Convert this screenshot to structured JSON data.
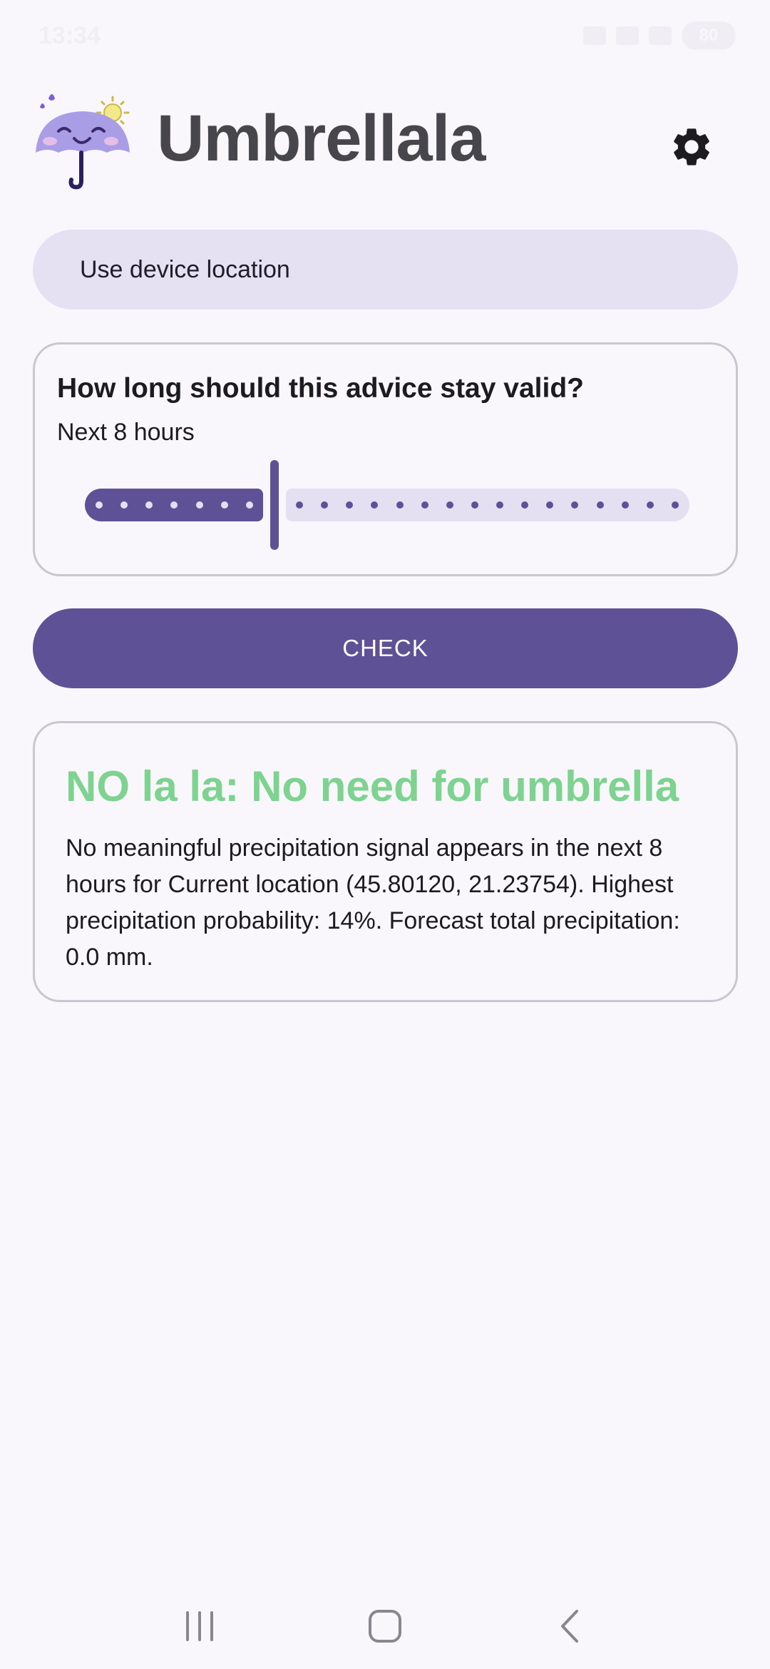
{
  "status_bar": {
    "time": "13:34",
    "battery": "80"
  },
  "header": {
    "title": "Umbrellala",
    "logo_icon": "umbrella-face-icon",
    "settings_icon": "gear-icon"
  },
  "location": {
    "label": "Use device location"
  },
  "validity": {
    "question": "How long should this advice stay valid?",
    "current": "Next 8 hours",
    "slider": {
      "value": 8,
      "min": 1,
      "max": 24
    }
  },
  "check": {
    "label": "CHECK"
  },
  "result": {
    "title": "NO la la: No need for umbrella",
    "body": "No meaningful precipitation signal appears in the next 8 hours for Current location (45.80120, 21.23754). Highest precipitation probability: 14%. Forecast total precipitation: 0.0 mm."
  },
  "colors": {
    "primary": "#5f5196",
    "primary_container": "#e5e0f2",
    "result_green": "#7dd38f",
    "background": "#f9f7fc"
  },
  "nav": {
    "recents_icon": "recents-icon",
    "home_icon": "home-icon",
    "back_icon": "back-icon"
  }
}
